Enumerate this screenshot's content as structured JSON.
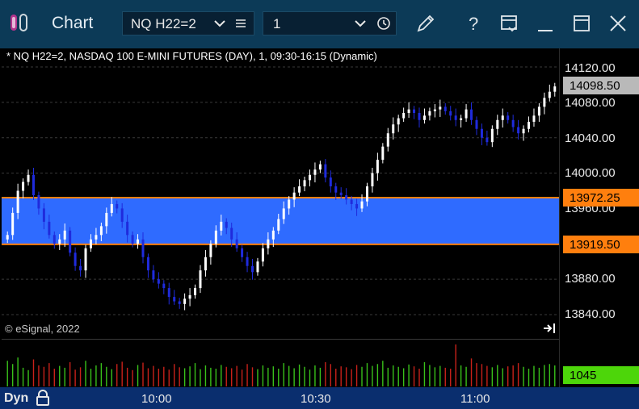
{
  "window": {
    "title": "Chart"
  },
  "toolbar": {
    "symbol_value": "NQ H22=2",
    "interval_value": "1",
    "icons": [
      "app-icon",
      "chevron-down-icon",
      "menu-icon",
      "chevron-down-icon",
      "clock-icon",
      "pencil-icon",
      "help-icon",
      "template-icon",
      "minimize-icon",
      "maximize-icon",
      "close-icon"
    ]
  },
  "chart": {
    "header": "* NQ H22=2, NASDAQ 100 E-MINI FUTURES (DAY), 1, 09:30-16:15 (Dynamic)",
    "copyright": "© eSignal, 2022",
    "price_labels": [
      "14120.00",
      "14080.00",
      "14040.00",
      "14000.00",
      "13960.00",
      "13880.00",
      "13840.00"
    ],
    "last_price": "14098.50",
    "upper_level": "13972.25",
    "lower_level": "13919.50",
    "volume_last": "1045",
    "time_labels": [
      "10:00",
      "10:30",
      "11:00"
    ],
    "mode_label": "Dyn",
    "colors": {
      "up": "#ffffff",
      "down": "#1f2bdc",
      "band": "#2f6bff",
      "band_edge": "#ff7f0e",
      "vol_up": "#39c11a",
      "vol_down": "#c8211a",
      "axis_bar": "#0a2e6e"
    }
  },
  "chart_data": {
    "type": "candlestick",
    "title": "* NQ H22=2, NASDAQ 100 E-MINI FUTURES (DAY), 1, 09:30-16:15 (Dynamic)",
    "ylim": [
      13820,
      14140
    ],
    "yticks": [
      14120,
      14080,
      14040,
      14000,
      13960,
      13880,
      13840
    ],
    "x_ticks": [
      "10:00",
      "10:30",
      "11:00"
    ],
    "last_price": 14098.5,
    "band": {
      "upper": 13972.25,
      "lower": 13919.5
    },
    "close": [
      13930,
      13955,
      13980,
      13990,
      13998,
      13975,
      13960,
      13945,
      13930,
      13920,
      13925,
      13935,
      13910,
      13895,
      13890,
      13915,
      13925,
      13930,
      13940,
      13955,
      13965,
      13960,
      13945,
      13930,
      13920,
      13925,
      13905,
      13890,
      13880,
      13875,
      13870,
      13860,
      13855,
      13852,
      13858,
      13862,
      13870,
      13890,
      13905,
      13920,
      13935,
      13945,
      13938,
      13925,
      13915,
      13905,
      13895,
      13888,
      13900,
      13915,
      13925,
      13935,
      13948,
      13960,
      13970,
      13978,
      13985,
      13992,
      13998,
      14004,
      14010,
      13995,
      13985,
      13978,
      13975,
      13970,
      13965,
      13960,
      13968,
      13985,
      14000,
      14015,
      14030,
      14045,
      14055,
      14062,
      14068,
      14072,
      14068,
      14060,
      14065,
      14070,
      14072,
      14075,
      14070,
      14065,
      14060,
      14062,
      14072,
      14060,
      14050,
      14040,
      14035,
      14050,
      14060,
      14065,
      14060,
      14052,
      14045,
      14050,
      14058,
      14065,
      14075,
      14085,
      14092,
      14098
    ],
    "volume": [
      55,
      48,
      62,
      40,
      35,
      58,
      45,
      42,
      50,
      38,
      44,
      40,
      52,
      36,
      41,
      55,
      38,
      45,
      50,
      42,
      37,
      48,
      53,
      40,
      35,
      46,
      51,
      39,
      44,
      38,
      42,
      36,
      48,
      41,
      39,
      43,
      50,
      37,
      45,
      40,
      38,
      46,
      42,
      39,
      44,
      36,
      48,
      41,
      37,
      45,
      40,
      43,
      38,
      50,
      44,
      39,
      47,
      42,
      36,
      45,
      40,
      52,
      48,
      38,
      43,
      41,
      37,
      46,
      42,
      50,
      44,
      48,
      55,
      40,
      45,
      42,
      39,
      47,
      43,
      38,
      52,
      46,
      41,
      44,
      40,
      38,
      90,
      45,
      42,
      60,
      50,
      48,
      44,
      41,
      46,
      39,
      43,
      45,
      50,
      42,
      38,
      44,
      40,
      46,
      48,
      45
    ]
  }
}
